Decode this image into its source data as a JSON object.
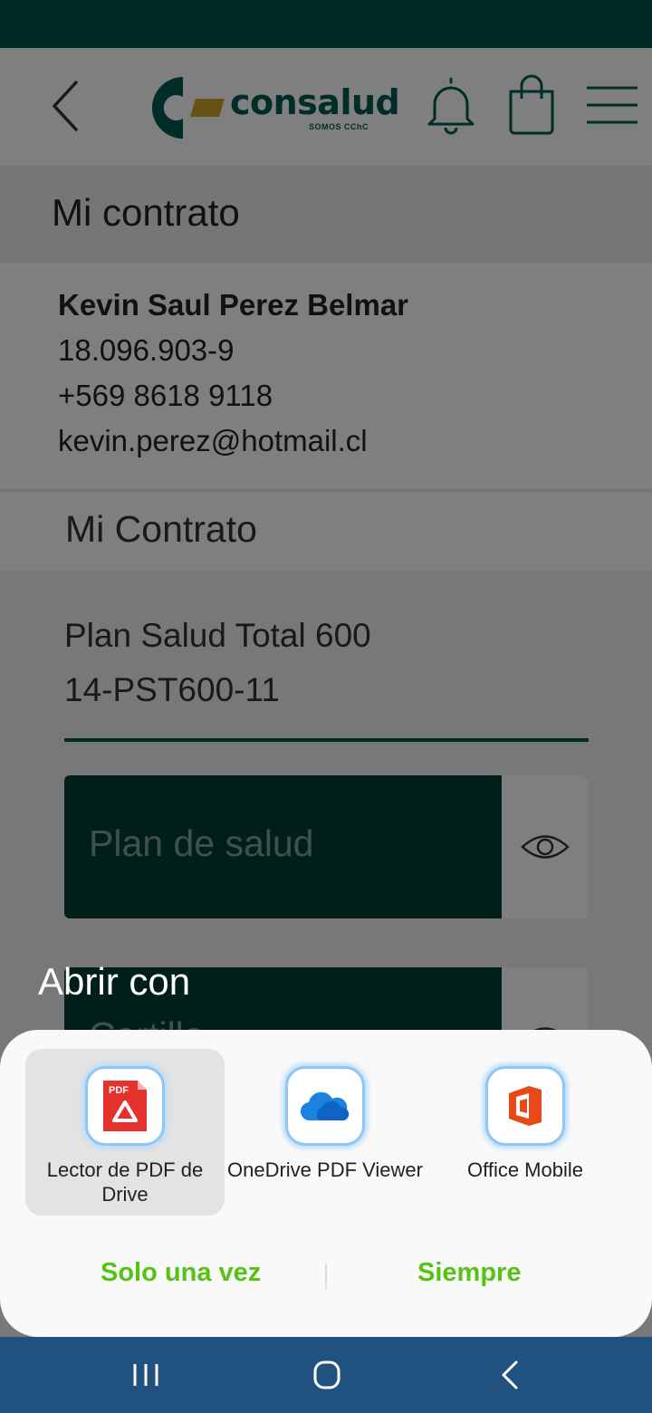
{
  "header": {
    "logo_text": "consalud",
    "logo_subtitle": "SOMOS CChC",
    "icons": [
      "back-icon",
      "bell-icon",
      "shopping-bag-icon",
      "hamburger-menu-icon"
    ]
  },
  "page": {
    "section_title": "Mi contrato"
  },
  "user": {
    "name": "Kevin Saul Perez Belmar",
    "rut": "18.096.903-9",
    "phone": "+569 8618 9118",
    "email": "kevin.perez@hotmail.cl"
  },
  "contract": {
    "title": "Mi Contrato",
    "plan_name": "Plan Salud Total 600",
    "plan_code": "14-PST600-11",
    "documents": [
      {
        "label": "Plan de salud"
      },
      {
        "label": "Cartilla"
      }
    ]
  },
  "dialog": {
    "title": "Abrir con",
    "apps": [
      {
        "label": "Lector de PDF de Drive",
        "icon": "drive-pdf-icon",
        "selected": true
      },
      {
        "label": "OneDrive PDF Viewer",
        "icon": "onedrive-icon",
        "selected": false
      },
      {
        "label": "Office Mobile",
        "icon": "office-icon",
        "selected": false
      }
    ],
    "pdf_badge": "PDF",
    "once_label": "Solo una vez",
    "always_label": "Siempre",
    "accent_color": "#55c214"
  },
  "colors": {
    "brand_teal": "#005a50",
    "brand_dark": "#003f36",
    "status_bar": "#002b24",
    "nav_bar": "#21527f"
  }
}
